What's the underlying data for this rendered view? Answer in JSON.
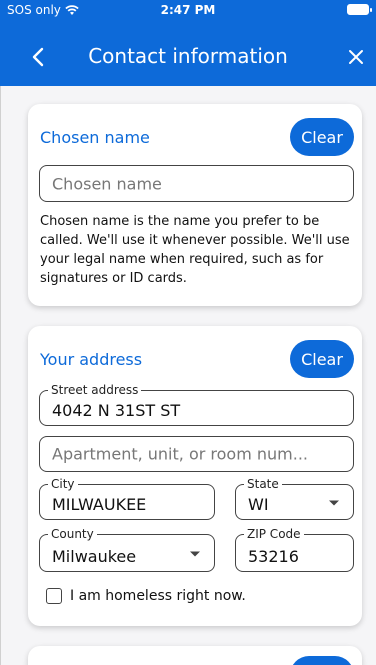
{
  "status_bar": {
    "carrier": "SOS only",
    "time": "2:47 PM"
  },
  "nav": {
    "title": "Contact information"
  },
  "chosen_name": {
    "title": "Chosen name",
    "clear_label": "Clear",
    "placeholder": "Chosen name",
    "help": "Chosen name is the name you prefer to be called. We'll use it whenever possible. We'll use your legal name when required, such as for signatures or ID cards."
  },
  "address": {
    "title": "Your address",
    "clear_label": "Clear",
    "street_label": "Street address",
    "street_value": "4042 N 31ST ST",
    "apt_placeholder": "Apartment, unit, or room num...",
    "city_label": "City",
    "city_value": "MILWAUKEE",
    "state_label": "State",
    "state_value": "WI",
    "county_label": "County",
    "county_value": "Milwaukee",
    "zip_label": "ZIP Code",
    "zip_value": "53216",
    "homeless_label": "I am homeless right now."
  },
  "colors": {
    "accent": "#0d6ad9"
  }
}
